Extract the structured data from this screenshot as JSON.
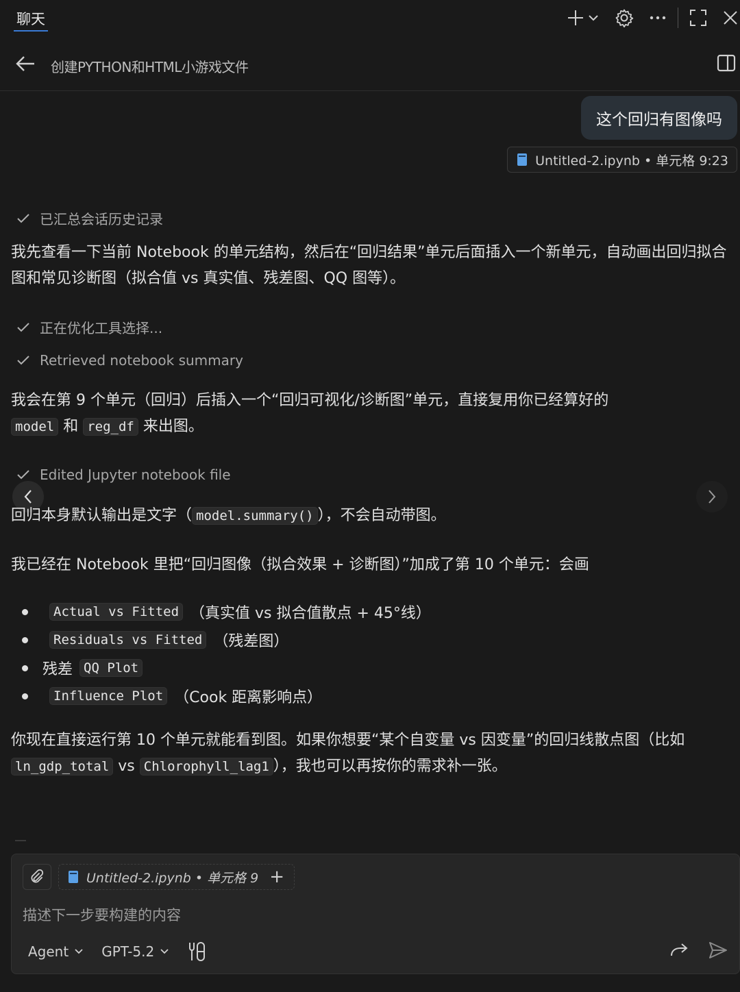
{
  "topbar": {
    "tab_label": "聊天",
    "icons": [
      "plus-icon",
      "chevron-down-icon",
      "gear-icon",
      "more-icon",
      "fullscreen-icon",
      "close-icon"
    ]
  },
  "header": {
    "title": "创建PYTHON和HTML小游戏文件"
  },
  "user_message": {
    "text": "这个回归有图像吗",
    "context_file": "Untitled-2.ipynb",
    "context_sep": "•",
    "context_cell": "单元格 9:23"
  },
  "steps": {
    "s1": "已汇总会话历史记录",
    "s2": "正在优化工具选择...",
    "s3": "Retrieved notebook summary",
    "s4": "Edited Jupyter notebook file"
  },
  "p1": "我先查看一下当前 Notebook 的单元结构，然后在“回归结果”单元后面插入一个新单元，自动画出回归拟合图和常见诊断图（拟合值 vs 真实值、残差图、QQ 图等）。",
  "p2": {
    "a": "我会在第 9 个单元（回归）后插入一个“回归可视化/诊断图”单元，直接复用你已经算好的",
    "code1": "model",
    "b": "和",
    "code2": "reg_df",
    "c": "来出图。"
  },
  "p3": {
    "a": "回归本身默认输出是文字（",
    "code": "model.summary()",
    "b": "），不会自动带图。"
  },
  "p4": "我已经在 Notebook 里把“回归图像（拟合效果 + 诊断图）”加成了第 10 个单元：会画",
  "bullets": [
    {
      "pre": "",
      "code": "Actual vs Fitted",
      "post": "（真实值 vs 拟合值散点 + 45°线）"
    },
    {
      "pre": "",
      "code": "Residuals vs Fitted",
      "post": "（残差图）"
    },
    {
      "pre": "残差",
      "code": "QQ Plot",
      "post": ""
    },
    {
      "pre": "",
      "code": "Influence Plot",
      "post": "（Cook 距离影响点）"
    }
  ],
  "p5": {
    "a": "你现在直接运行第 10 个单元就能看到图。如果你想要“某个自变量 vs 因变量”的回归线散点图（比如",
    "code1": "ln_gdp_total",
    "b": "vs",
    "code2": "Chlorophyll_lag1",
    "c": "），我也可以再按你的需求补一张。"
  },
  "composer": {
    "chip_file": "Untitled-2.ipynb",
    "chip_sep": "•",
    "chip_cell": "单元格 9",
    "chip_plus": "+",
    "placeholder": "描述下一步要构建的内容",
    "mode": "Agent",
    "model": "GPT-5.2"
  },
  "colors": {
    "background": "#1a1a1a",
    "accent": "#3a7bd5",
    "user_bubble": "#2a3138",
    "code_bg": "#2b2b2b"
  }
}
